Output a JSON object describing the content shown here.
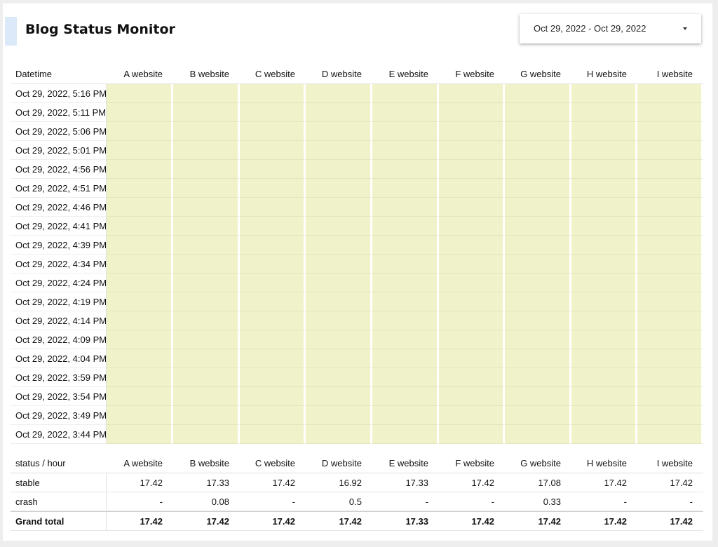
{
  "header": {
    "title": "Blog Status Monitor",
    "date_range": "Oct 29, 2022 - Oct 29, 2022"
  },
  "status_table": {
    "first_header": "Datetime",
    "columns": [
      "A website",
      "B website",
      "C website",
      "D website",
      "E website",
      "F website",
      "G website",
      "H website",
      "I website"
    ],
    "rows": [
      "Oct 29, 2022, 5:16 PM",
      "Oct 29, 2022, 5:11 PM",
      "Oct 29, 2022, 5:06 PM",
      "Oct 29, 2022, 5:01 PM",
      "Oct 29, 2022, 4:56 PM",
      "Oct 29, 2022, 4:51 PM",
      "Oct 29, 2022, 4:46 PM",
      "Oct 29, 2022, 4:41 PM",
      "Oct 29, 2022, 4:39 PM",
      "Oct 29, 2022, 4:34 PM",
      "Oct 29, 2022, 4:24 PM",
      "Oct 29, 2022, 4:19 PM",
      "Oct 29, 2022, 4:14 PM",
      "Oct 29, 2022, 4:09 PM",
      "Oct 29, 2022, 4:04 PM",
      "Oct 29, 2022, 3:59 PM",
      "Oct 29, 2022, 3:54 PM",
      "Oct 29, 2022, 3:49 PM",
      "Oct 29, 2022, 3:44 PM"
    ],
    "cell_color": "#f0f2c9"
  },
  "summary_table": {
    "first_header": "status / hour",
    "columns": [
      "A website",
      "B website",
      "C website",
      "D website",
      "E website",
      "F website",
      "G website",
      "H website",
      "I website"
    ],
    "rows": [
      {
        "label": "stable",
        "values": [
          "17.42",
          "17.33",
          "17.42",
          "16.92",
          "17.33",
          "17.42",
          "17.08",
          "17.42",
          "17.42"
        ]
      },
      {
        "label": "crash",
        "values": [
          "-",
          "0.08",
          "-",
          "0.5",
          "-",
          "-",
          "0.33",
          "-",
          "-"
        ]
      }
    ],
    "total": {
      "label": "Grand total",
      "values": [
        "17.42",
        "17.42",
        "17.42",
        "17.42",
        "17.33",
        "17.42",
        "17.42",
        "17.42",
        "17.42"
      ]
    }
  },
  "colors": {
    "accent": "#dbe9f8",
    "cell_fill": "#f0f2c9",
    "background": "#eeeeee"
  }
}
